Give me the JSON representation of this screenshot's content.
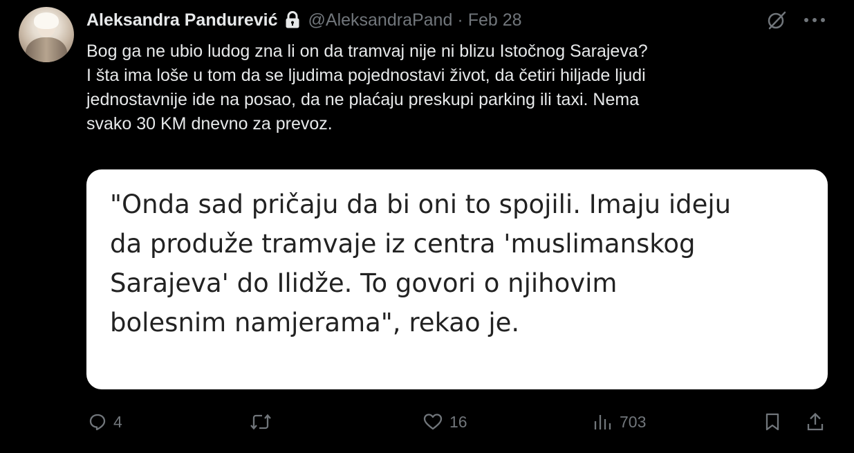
{
  "tweet": {
    "author_name": "Aleksandra Pandurević",
    "handle": "@AleksandraPand",
    "separator": "·",
    "date": "Feb 28",
    "text_lines": [
      "Bog ga ne ubio ludog zna li on da tramvaj nije ni blizu Istočnog Sarajeva?",
      "I šta ima loše u tom da se ljudima pojednostavi život, da četiri hiljade ljudi",
      "jednostavnije ide na posao, da ne plaćaju preskupi parking ili taxi. Nema",
      "svako 30 KM dnevno za prevoz."
    ],
    "media_quote_lines": [
      "\"Onda sad pričaju da bi oni to spojili. Imaju ideju",
      "da produže tramvaje iz centra 'muslimanskog",
      "Sarajeva' do Ilidže. To govori o njihovim",
      "bolesnim namjerama\", rekao je."
    ],
    "actions": {
      "reply_count": "4",
      "retweet_count": "",
      "like_count": "16",
      "views_count": "703"
    },
    "icons": {
      "lock": "lock-icon",
      "grok": "grok-icon",
      "more": "more-icon",
      "reply": "reply-icon",
      "retweet": "retweet-icon",
      "like": "heart-icon",
      "views": "views-icon",
      "bookmark": "bookmark-icon",
      "share": "share-icon"
    },
    "colors": {
      "background": "#000000",
      "primary_text": "#e7e9ea",
      "secondary_text": "#71767b"
    }
  }
}
